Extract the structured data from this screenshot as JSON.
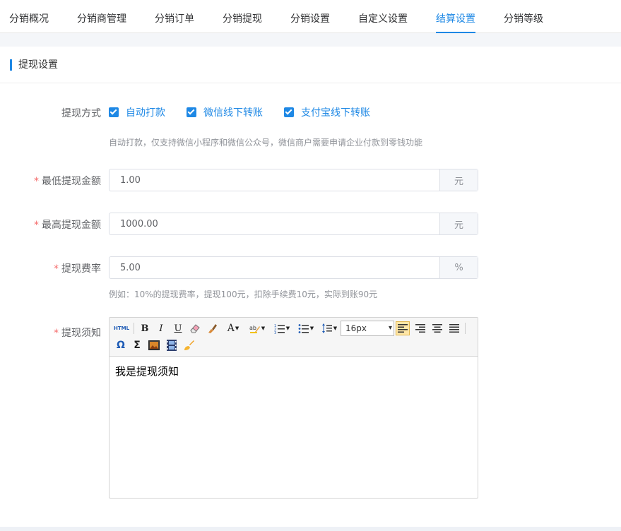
{
  "tabs": [
    {
      "label": "分销概况"
    },
    {
      "label": "分销商管理"
    },
    {
      "label": "分销订单"
    },
    {
      "label": "分销提现"
    },
    {
      "label": "分销设置"
    },
    {
      "label": "自定义设置"
    },
    {
      "label": "结算设置",
      "active": true
    },
    {
      "label": "分销等级"
    }
  ],
  "section": {
    "title": "提现设置"
  },
  "withdraw_method": {
    "label": "提现方式",
    "options": [
      {
        "label": "自动打款",
        "checked": true
      },
      {
        "label": "微信线下转账",
        "checked": true
      },
      {
        "label": "支付宝线下转账",
        "checked": true
      }
    ],
    "hint": "自动打款，仅支持微信小程序和微信公众号，微信商户需要申请企业付款到零钱功能"
  },
  "min_amount": {
    "required_mark": "*",
    "label": "最低提现金额",
    "value": "1.00",
    "suffix": "元"
  },
  "max_amount": {
    "required_mark": "*",
    "label": "最高提现金额",
    "value": "1000.00",
    "suffix": "元"
  },
  "fee_rate": {
    "required_mark": "*",
    "label": "提现费率",
    "value": "5.00",
    "suffix": "%",
    "hint": "例如：10%的提现费率，提现100元，扣除手续费10元，实际到账90元"
  },
  "notice": {
    "required_mark": "*",
    "label": "提现须知",
    "font_size_value": "16px",
    "content": "我是提现须知",
    "html_button": "HTML",
    "bold": "B",
    "italic": "I",
    "underline": "U",
    "font_color": "A",
    "omega": "Ω",
    "sigma": "Σ"
  },
  "colors": {
    "accent": "#1e88e5",
    "required": "#f56c6c"
  }
}
